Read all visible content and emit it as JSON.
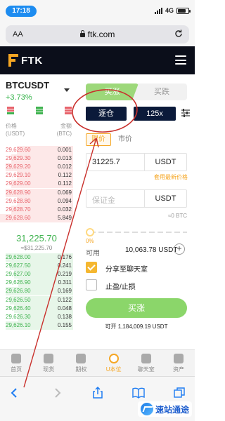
{
  "status_bar": {
    "time": "17:18",
    "network": "4G"
  },
  "browser": {
    "text_size": "AA",
    "url": "ftk.com"
  },
  "app": {
    "logo_text": "FTK"
  },
  "pair": {
    "name": "BTCUSDT",
    "change": "+3.73%"
  },
  "orderbook": {
    "col_price": [
      "价格",
      "(USDT)"
    ],
    "col_amount": [
      "金额",
      "(BTC)"
    ],
    "asks": [
      {
        "price": "29,629.60",
        "qty": "0.001"
      },
      {
        "price": "29,629.30",
        "qty": "0.013"
      },
      {
        "price": "29,629.20",
        "qty": "0.012"
      },
      {
        "price": "29,629.10",
        "qty": "0.112"
      },
      {
        "price": "29,629.00",
        "qty": "0.112"
      },
      {
        "price": "29,628.90",
        "qty": "0.069"
      },
      {
        "price": "29,628.80",
        "qty": "0.094"
      },
      {
        "price": "29,628.70",
        "qty": "0.032"
      },
      {
        "price": "29,628.60",
        "qty": "5.849"
      }
    ],
    "last_price": "31,225.70",
    "last_price_sub": "≈$31,225.70",
    "bids": [
      {
        "price": "29,628.00",
        "qty": "0.176"
      },
      {
        "price": "29,627.50",
        "qty": "0.241"
      },
      {
        "price": "29,627.00",
        "qty": "0.219"
      },
      {
        "price": "29,626.90",
        "qty": "0.311"
      },
      {
        "price": "29,626.80",
        "qty": "0.169"
      },
      {
        "price": "29,626.50",
        "qty": "0.122"
      },
      {
        "price": "29,626.40",
        "qty": "0.048"
      },
      {
        "price": "29,626.30",
        "qty": "0.138"
      },
      {
        "price": "29,626.10",
        "qty": "0.155"
      }
    ]
  },
  "trade": {
    "tab_buy": "买涨",
    "tab_sell": "买跌",
    "margin_mode": "逐仓",
    "leverage": "125x",
    "type_limit": "限价",
    "type_market": "市价",
    "price_value": "31225.7",
    "price_unit": "USDT",
    "latest_price_link": "套用最新价格",
    "margin_placeholder": "保证金",
    "margin_unit": "USDT",
    "approx": "≈0 BTC",
    "slider_pct": "0%",
    "available_label": "可用",
    "available_value": "10,063.78 USDT",
    "share_label": "分享至聊天室",
    "share_checked": true,
    "tpsl_label": "止盈/止损",
    "tpsl_checked": false,
    "submit_label": "买涨",
    "can_open_label": "可开",
    "can_open_value": "1,184,009.19 USDT"
  },
  "tabbar": {
    "items": [
      {
        "label": "首页"
      },
      {
        "label": "现货"
      },
      {
        "label": "期权"
      },
      {
        "label": "U本位"
      },
      {
        "label": "聊天室"
      },
      {
        "label": "资产"
      }
    ],
    "active_index": 3
  },
  "watermark": {
    "text": "速站通途"
  },
  "colors": {
    "accent": "#f5a623",
    "buy": "#8bd66a",
    "ask_text": "#e8636b",
    "bid_text": "#3fb34f",
    "header_bg": "#0b0e1a",
    "annotation": "#c9302c"
  }
}
